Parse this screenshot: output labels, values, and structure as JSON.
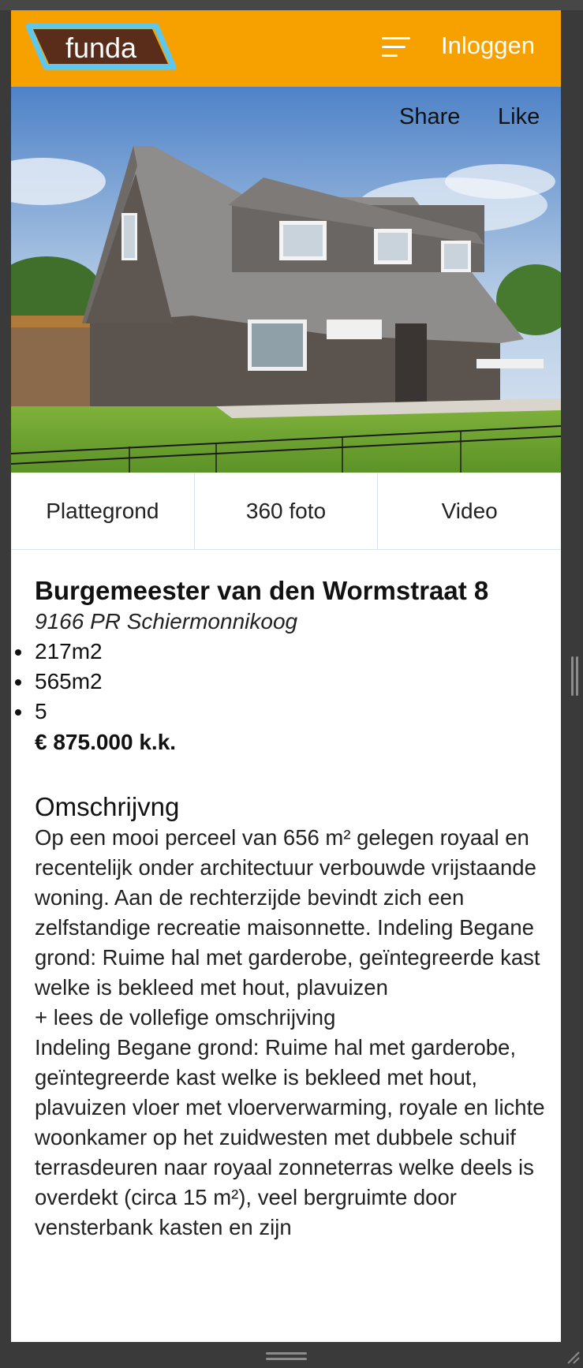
{
  "header": {
    "logo_text": "funda",
    "login_label": "Inloggen",
    "menu_icon": "hamburger-menu-icon",
    "brand_color": "#f7a100",
    "logo_dark": "#5a2d1a",
    "logo_accent": "#5cc8f0"
  },
  "hero": {
    "share_label": "Share",
    "like_label": "Like"
  },
  "media_tabs": [
    {
      "label": "Plattegrond"
    },
    {
      "label": "360 foto"
    },
    {
      "label": "Video"
    }
  ],
  "listing": {
    "street": "Burgemeester van den Wormstraat 8",
    "postal_city": "9166 PR Schiermonnikoog",
    "features": [
      "217m2",
      "565m2",
      "5"
    ],
    "price": "€ 875.000 k.k."
  },
  "description": {
    "heading": "Omschrijvng",
    "intro": "Op een mooi perceel van 656 m² gelegen royaal en recentelijk onder architectuur verbouwde vrijstaande woning. Aan de rechterzijde bevindt zich een zelfstandige recreatie maisonnette. Indeling Begane grond: Ruime hal met garderobe, geïntegreerde kast welke is bekleed met hout, plavuizen",
    "read_more_label": "+ lees de vollefige omschrijving",
    "full": "Indeling Begane grond: Ruime hal met garderobe, geïntegreerde kast welke is bekleed met hout, plavuizen vloer met vloerverwarming, royale en lichte woonkamer op het zuidwesten met dubbele schuif terrasdeuren naar royaal zonneterras welke deels is overdekt (circa 15 m²), veel bergruimte door vensterbank kasten en zijn"
  }
}
